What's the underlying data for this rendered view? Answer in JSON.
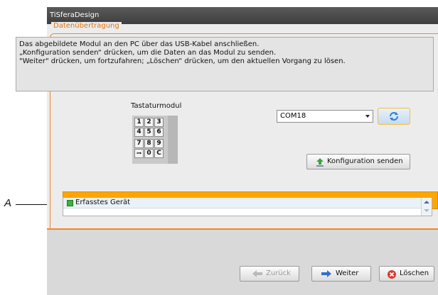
{
  "annotation": {
    "letter": "A"
  },
  "window": {
    "title": "TiSferaDesign"
  },
  "group": {
    "legend": "Datenübertragung"
  },
  "info": {
    "lines": [
      "Das abgebildete Modul an den PC über das USB-Kabel anschließen.",
      "„Konfiguration senden“ drücken, um die Daten an das Modul zu senden.",
      "\"Weiter\" drücken, um fortzufahren; „Löschen“ drücken, um den aktuellen Vorgang zu lösen."
    ]
  },
  "module": {
    "label": "Tastaturmodul",
    "keys": [
      [
        "1",
        "2",
        "3"
      ],
      [
        "4",
        "5",
        "6"
      ],
      [
        "7",
        "8",
        "9"
      ],
      [
        "⊶",
        "0",
        "C"
      ]
    ]
  },
  "port": {
    "selected": "COM18",
    "refresh_icon": "refresh-icon"
  },
  "buttons": {
    "send": "Konfiguration senden",
    "back": "Zurück",
    "next": "Weiter",
    "delete": "Löschen"
  },
  "progress": {
    "value": 1.0,
    "color": "#ffa500"
  },
  "status": {
    "text": "Erfasstes Gerät",
    "led_color": "#3bb33b"
  }
}
